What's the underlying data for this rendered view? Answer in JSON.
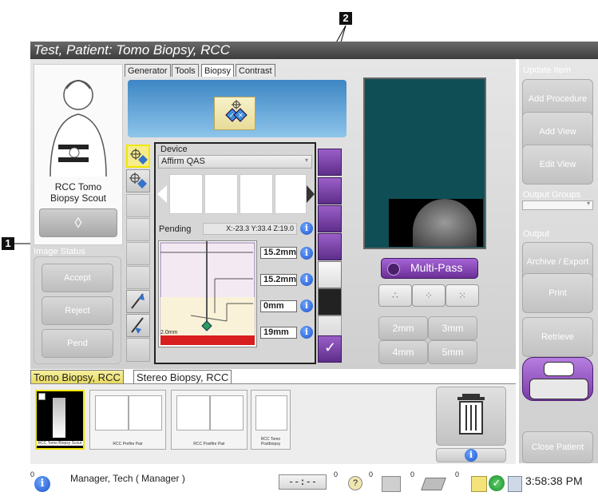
{
  "patient_title": "Test, Patient:  Tomo Biopsy, RCC",
  "tabs": [
    "Generator",
    "Tools",
    "Biopsy",
    "Contrast"
  ],
  "active_tab": "Biopsy",
  "view_label": "RCC Tomo Biopsy Scout",
  "image_status": {
    "label": "Image Status",
    "buttons": [
      "Accept",
      "Reject",
      "Pend"
    ]
  },
  "device": {
    "label": "Device",
    "selected": "Affirm QAS"
  },
  "targeting": {
    "status": "Pending",
    "coords": "X:-23.3 Y:33.4 Z:19.0",
    "values": [
      "15.2mm",
      "15.2mm",
      "0mm",
      "19mm"
    ],
    "scale_label": "2.0mm"
  },
  "multipass": {
    "label": "Multi-Pass",
    "offsets": [
      "2mm",
      "3mm",
      "4mm",
      "5mm"
    ]
  },
  "right_panel": {
    "update_item": "Update Item",
    "add_procedure": "Add Procedure",
    "add_view": "Add View",
    "edit_view": "Edit View",
    "output_groups": "Output Groups",
    "output": "Output",
    "archive_export": "Archive / Export",
    "print": "Print",
    "retrieve": "Retrieve",
    "close_patient": "Close Patient"
  },
  "procedure_tabs": [
    "Tomo Biopsy, RCC",
    "Stereo Biopsy, RCC"
  ],
  "thumbnails": [
    {
      "caption": "RCC Tomo Biopsy Scout"
    },
    {
      "caption": "RCC Prefire Pair"
    },
    {
      "caption": "RCC Postfire Pair"
    },
    {
      "caption": "RCC Tomo Postbiopsy"
    }
  ],
  "status_bar": {
    "alert_count": "0",
    "user": "Manager, Tech ( Manager )",
    "timer": "--:--",
    "counts": [
      "0",
      "0",
      "0",
      "0"
    ],
    "time": "3:58:38 PM"
  },
  "callouts": [
    "1",
    "2"
  ],
  "colors": {
    "active_tab": "#ffffff",
    "purple_button": "#6a35a0",
    "selection_yellow": "#f2e600",
    "info_blue": "#2a63d6"
  }
}
